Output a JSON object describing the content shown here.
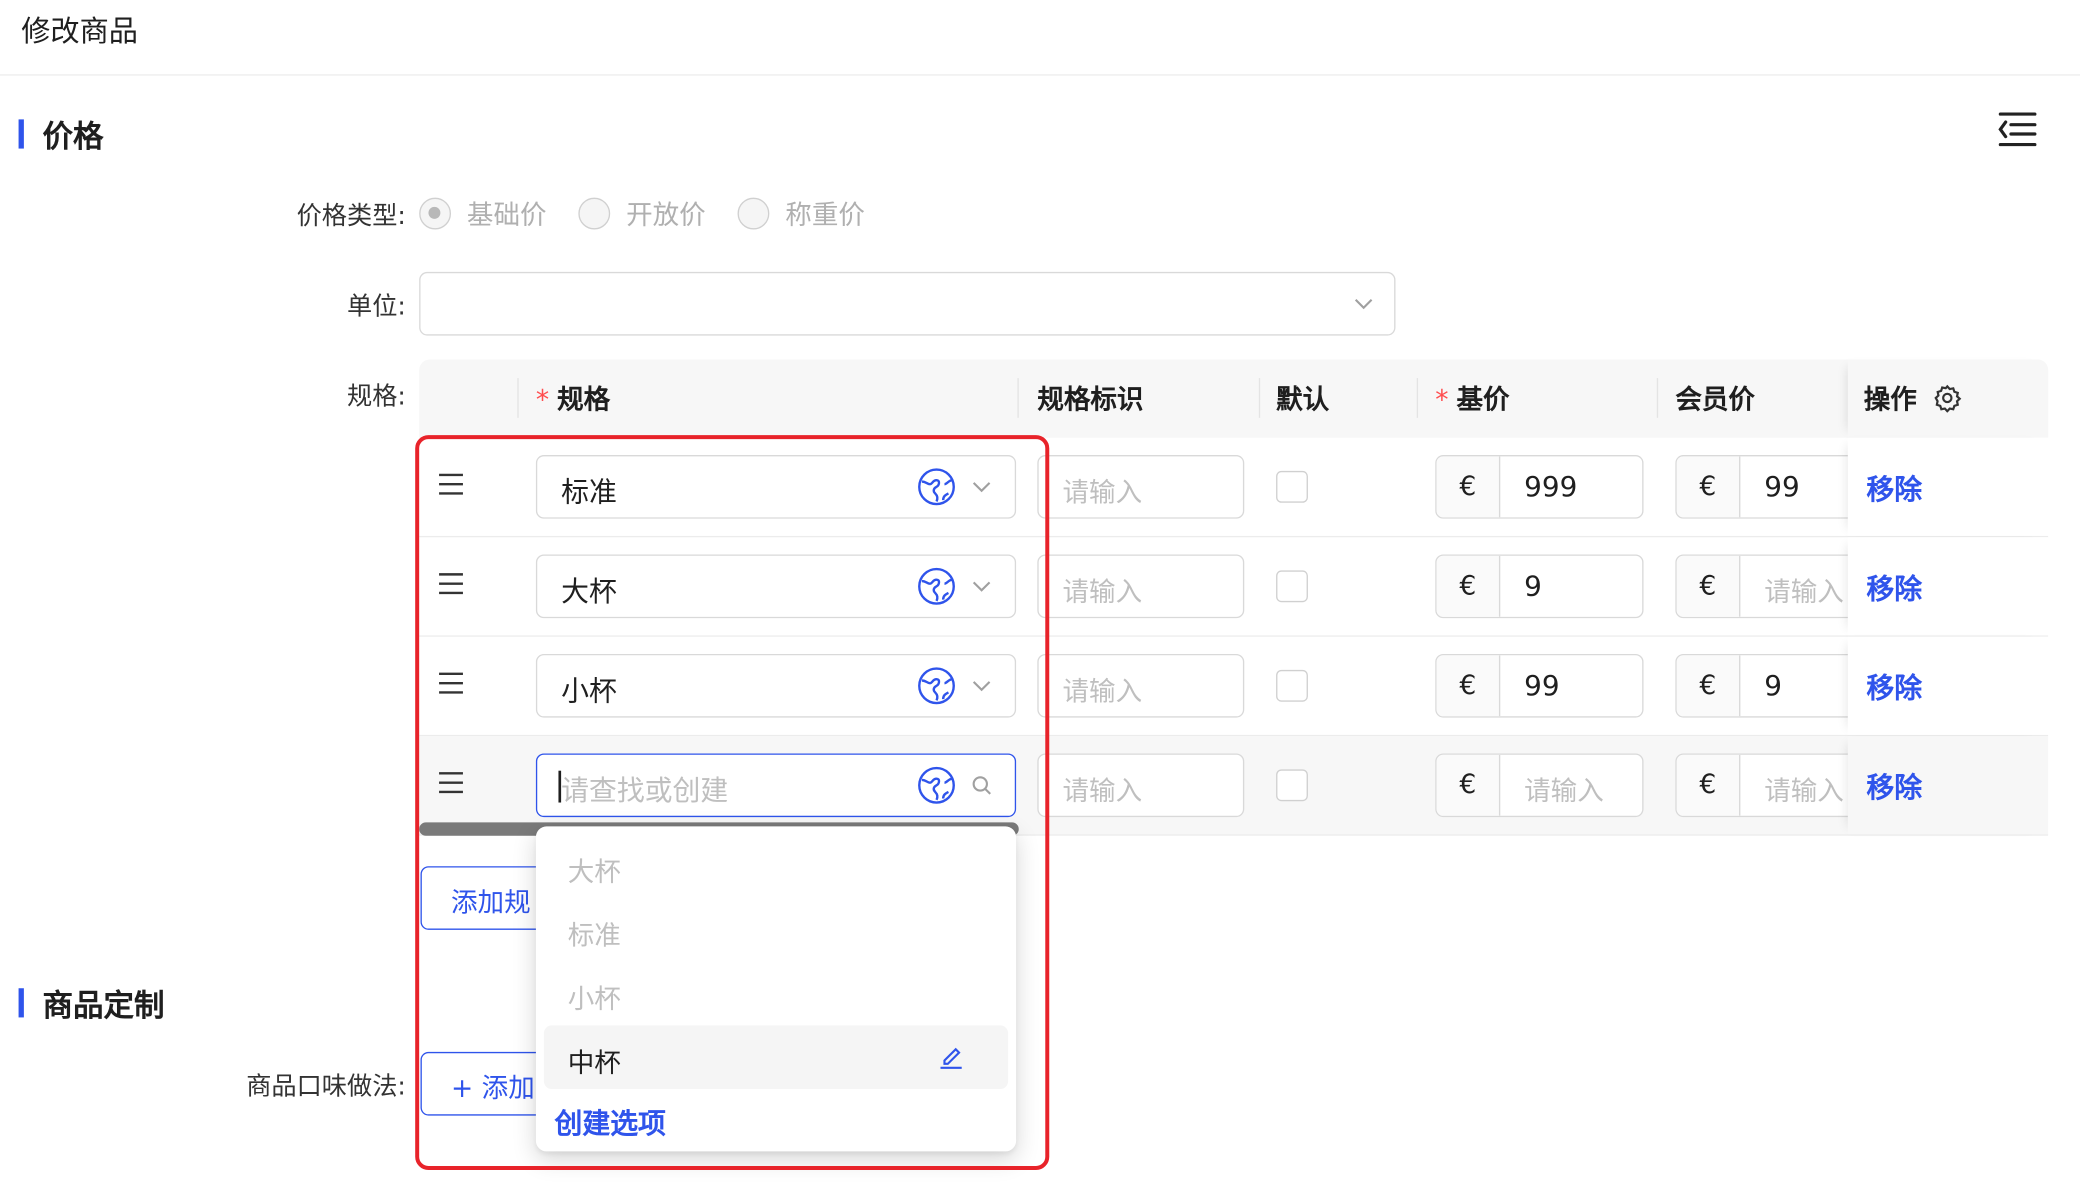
{
  "page": {
    "title": "修改商品"
  },
  "price_section": {
    "title": "价格",
    "price_type": {
      "label": "价格类型:",
      "options": [
        "基础价",
        "开放价",
        "称重价"
      ],
      "selected": "基础价"
    },
    "unit": {
      "label": "单位:",
      "value": ""
    },
    "spec_label": "规格:"
  },
  "spec_table": {
    "headers": {
      "spec": "规格",
      "spec_id": "规格标识",
      "default": "默认",
      "base_price": "基价",
      "member_price": "会员价",
      "action": "操作"
    },
    "required_mark": "*",
    "currency": "€",
    "placeholder": "请输入",
    "search_placeholder": "请查找或创建",
    "remove_label": "移除",
    "rows": [
      {
        "spec": "标准",
        "spec_id": "",
        "default": false,
        "base_price": "999",
        "member_price": "99"
      },
      {
        "spec": "大杯",
        "spec_id": "",
        "default": false,
        "base_price": "9",
        "member_price": ""
      },
      {
        "spec": "小杯",
        "spec_id": "",
        "default": false,
        "base_price": "99",
        "member_price": "9"
      },
      {
        "spec": "",
        "spec_id": "",
        "default": false,
        "base_price": "",
        "member_price": ""
      }
    ],
    "add_button": "添加规"
  },
  "dropdown": {
    "options": [
      "大杯",
      "标准",
      "小杯"
    ],
    "active_option": "中杯",
    "create_label": "创建选项"
  },
  "customize_section": {
    "title": "商品定制",
    "flavor_label": "商品口味做法:",
    "add_button": "+ 添加"
  },
  "colors": {
    "accent": "#2f54eb",
    "required": "#ff4d4f",
    "highlight_frame": "#e8232a"
  },
  "icons": {
    "drag": "drag-handle-icon",
    "globe": "globe-translate-icon",
    "chevron": "chevron-down-icon",
    "search": "search-icon",
    "settings": "gear-icon",
    "collapse": "menu-collapse-icon",
    "edit": "edit-pencil-icon"
  }
}
